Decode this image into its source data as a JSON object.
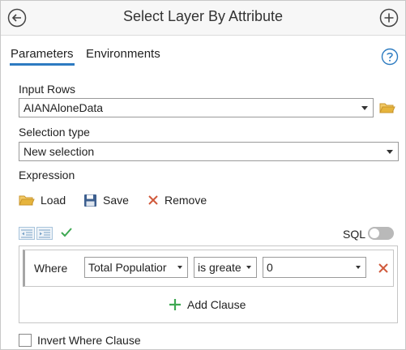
{
  "header": {
    "title": "Select Layer By Attribute",
    "back_icon": "circle-arrow-left-icon",
    "add_icon": "circle-plus-icon"
  },
  "tabs": [
    {
      "label": "Parameters",
      "active": true
    },
    {
      "label": "Environments",
      "active": false
    }
  ],
  "help_icon": "question-circle-icon",
  "input_rows": {
    "label": "Input Rows",
    "value": "AIANAloneData",
    "browse_icon": "folder-icon"
  },
  "selection_type": {
    "label": "Selection type",
    "value": "New selection"
  },
  "expression": {
    "label": "Expression",
    "actions": [
      {
        "label": "Load",
        "icon": "folder-open-icon"
      },
      {
        "label": "Save",
        "icon": "floppy-disk-icon"
      },
      {
        "label": "Remove",
        "icon": "x-icon"
      }
    ]
  },
  "toolbar": {
    "sql_label": "SQL",
    "sql_enabled": false
  },
  "clause": {
    "where_label": "Where",
    "field": "Total Populatior",
    "operator": "is greate",
    "value": "0"
  },
  "add_clause_label": "Add Clause",
  "invert": {
    "label": "Invert Where Clause",
    "checked": false
  },
  "colors": {
    "accent": "#2d7bc1",
    "folder": "#e6b43c",
    "remove": "#d05a3c",
    "add": "#3ea852",
    "check": "#3ea852"
  }
}
